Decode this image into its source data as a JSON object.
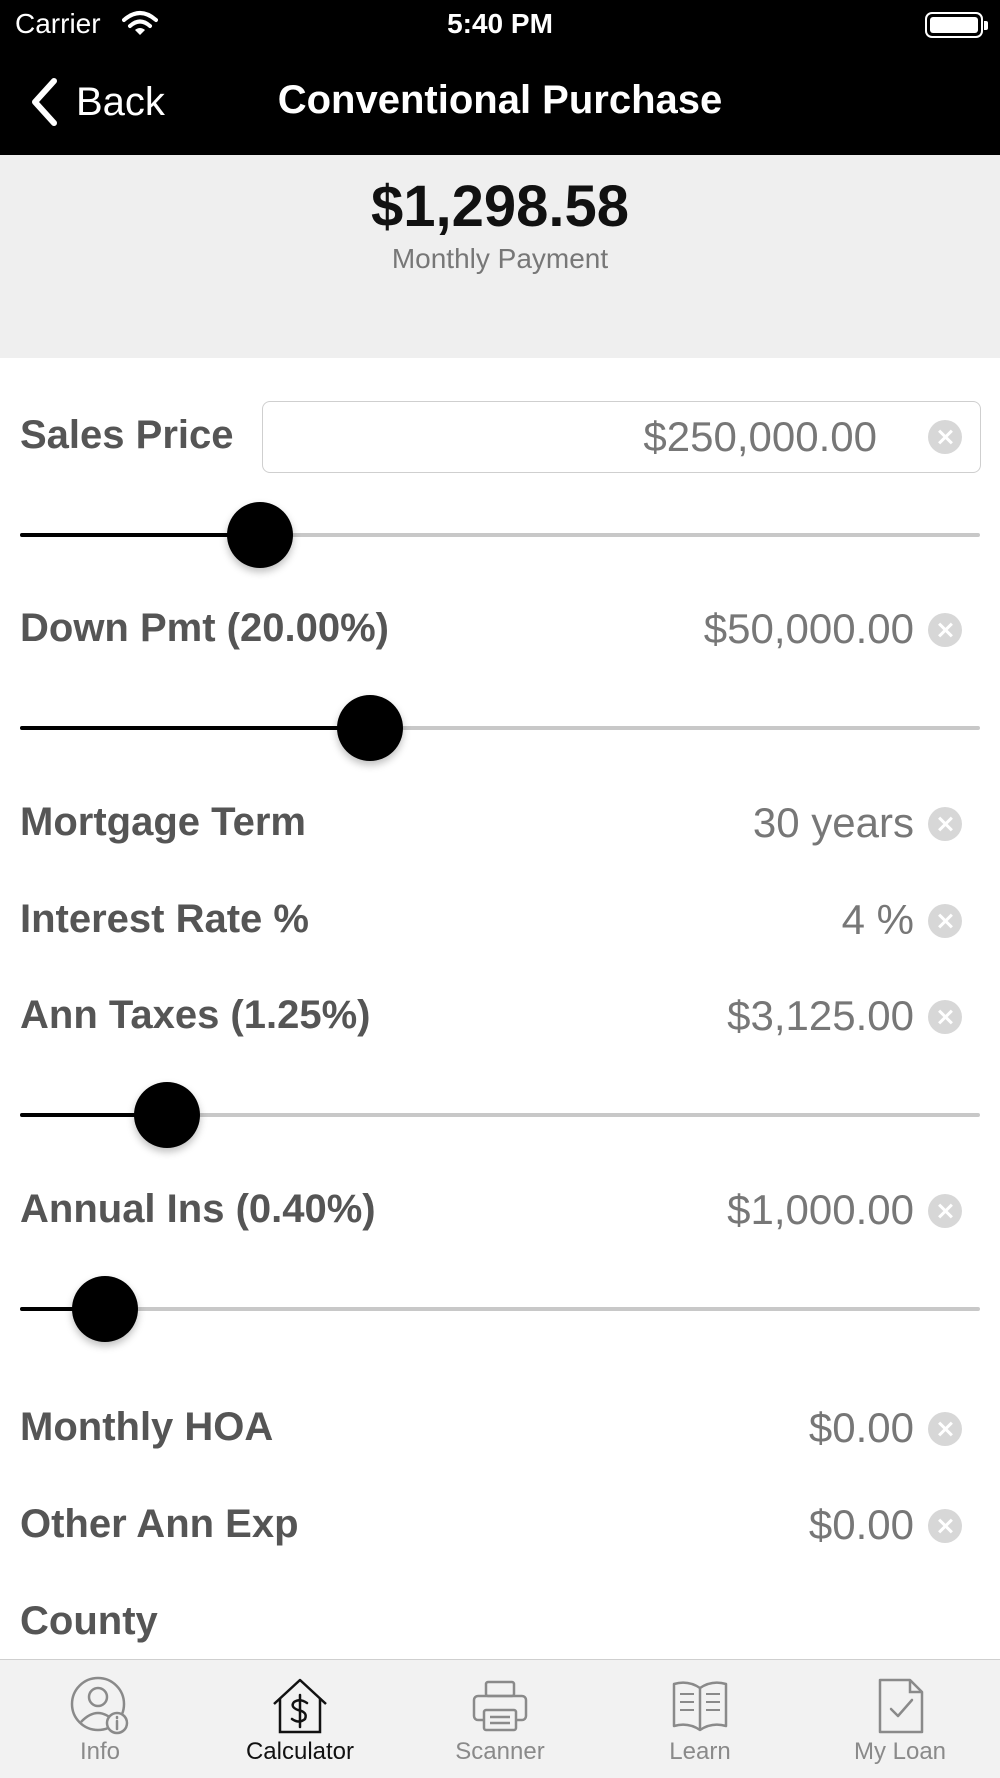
{
  "status_bar": {
    "carrier": "Carrier",
    "time": "5:40 PM"
  },
  "nav": {
    "back_label": "Back",
    "title": "Conventional Purchase"
  },
  "summary": {
    "monthly_payment": "$1,298.58",
    "monthly_payment_label": "Monthly Payment"
  },
  "fields": {
    "sales_price": {
      "label": "Sales Price",
      "value": "$250,000.00",
      "slider_fraction": 0.25
    },
    "down_payment": {
      "label": "Down Pmt (20.00%)",
      "value": "$50,000.00",
      "slider_fraction": 0.365
    },
    "mortgage_term": {
      "label": "Mortgage Term",
      "value": "30 years"
    },
    "interest_rate": {
      "label": "Interest Rate %",
      "value": "4 %"
    },
    "annual_taxes": {
      "label": "Ann Taxes (1.25%)",
      "value": "$3,125.00",
      "slider_fraction": 0.153
    },
    "annual_ins": {
      "label": "Annual Ins (0.40%)",
      "value": "$1,000.00",
      "slider_fraction": 0.089
    },
    "monthly_hoa": {
      "label": "Monthly HOA",
      "value": "$0.00"
    },
    "other_ann_exp": {
      "label": "Other Ann Exp",
      "value": "$0.00"
    },
    "county": {
      "label": "County"
    }
  },
  "tab_bar": {
    "active": "calculator",
    "tabs": [
      {
        "id": "info",
        "label": "Info",
        "icon": "person-info-icon"
      },
      {
        "id": "calculator",
        "label": "Calculator",
        "icon": "house-dollar-icon"
      },
      {
        "id": "scanner",
        "label": "Scanner",
        "icon": "printer-icon"
      },
      {
        "id": "learn",
        "label": "Learn",
        "icon": "open-book-icon"
      },
      {
        "id": "my_loan",
        "label": "My Loan",
        "icon": "document-check-icon"
      }
    ]
  },
  "colors": {
    "nav_background": "#000000",
    "summary_background": "#efefef",
    "label_text": "#555555",
    "value_text": "#777777"
  }
}
